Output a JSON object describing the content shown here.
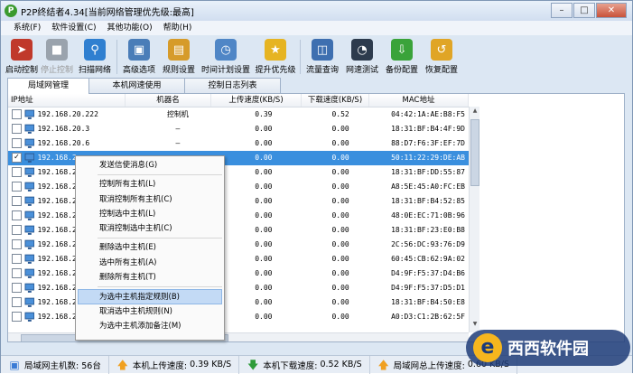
{
  "window": {
    "title": "P2P终结者4.34[当前网络管理优先级:最高]",
    "icon": "p2p-app-icon"
  },
  "menu": [
    "系统(F)",
    "软件设置(C)",
    "其他功能(O)",
    "帮助(H)"
  ],
  "toolbar": [
    {
      "label": "启动控制",
      "icon": "rocket-icon",
      "color": "#c0392b",
      "disabled": false
    },
    {
      "label": "停止控制",
      "icon": "stop-icon",
      "color": "#9aa3ad",
      "disabled": true
    },
    {
      "label": "扫描网络",
      "icon": "magnifier-icon",
      "color": "#2f7fd0",
      "disabled": false
    },
    {
      "label": "高级选项",
      "icon": "monitor-icon",
      "color": "#4a7db8",
      "disabled": false
    },
    {
      "label": "规则设置",
      "icon": "clipboard-icon",
      "color": "#d69b2a",
      "disabled": false
    },
    {
      "label": "时间计划设置",
      "icon": "clock-icon",
      "color": "#4f86c6",
      "disabled": false
    },
    {
      "label": "提升优先级",
      "icon": "medal-icon",
      "color": "#e6b422",
      "disabled": false
    },
    {
      "label": "流量查询",
      "icon": "database-icon",
      "color": "#3e6fb0",
      "disabled": false
    },
    {
      "label": "网速测试",
      "icon": "gauge-icon",
      "color": "#2d3b4d",
      "disabled": false
    },
    {
      "label": "备份配置",
      "icon": "download-arrow-icon",
      "color": "#3aa33a",
      "disabled": false
    },
    {
      "label": "恢复配置",
      "icon": "restore-icon",
      "color": "#e0a526",
      "disabled": false
    }
  ],
  "tabs": [
    "局域网管理",
    "本机网速使用",
    "控制日志列表"
  ],
  "grid": {
    "headers": [
      "IP地址",
      "机器名",
      "上传速度(KB/S)",
      "下载速度(KB/S)",
      "MAC地址"
    ],
    "rows": [
      {
        "ip": "192.168.20.222",
        "name": "控制机",
        "up": "0.39",
        "down": "0.52",
        "mac": "04:42:1A:AE:B8:F5",
        "checked": false,
        "selected": false
      },
      {
        "ip": "192.168.20.3",
        "name": "—",
        "up": "0.00",
        "down": "0.00",
        "mac": "18:31:BF:B4:4F:9D",
        "checked": false,
        "selected": false
      },
      {
        "ip": "192.168.20.6",
        "name": "—",
        "up": "0.00",
        "down": "0.00",
        "mac": "88:D7:F6:3F:EF:7D",
        "checked": false,
        "selected": false
      },
      {
        "ip": "192.168.2",
        "name": "",
        "up": "0.00",
        "down": "0.00",
        "mac": "50:11:22:29:DE:AB",
        "checked": true,
        "selected": true
      },
      {
        "ip": "192.168.2",
        "name": "",
        "up": "0.00",
        "down": "0.00",
        "mac": "18:31:BF:DD:55:87",
        "checked": false,
        "selected": false
      },
      {
        "ip": "192.168.2",
        "name": "",
        "up": "0.00",
        "down": "0.00",
        "mac": "A8:5E:45:A0:FC:EB",
        "checked": false,
        "selected": false
      },
      {
        "ip": "192.168.2",
        "name": "",
        "up": "0.00",
        "down": "0.00",
        "mac": "18:31:BF:B4:52:85",
        "checked": false,
        "selected": false
      },
      {
        "ip": "192.168.2",
        "name": "",
        "up": "0.00",
        "down": "0.00",
        "mac": "48:0E:EC:71:0B:96",
        "checked": false,
        "selected": false
      },
      {
        "ip": "192.168.2",
        "name": "",
        "up": "0.00",
        "down": "0.00",
        "mac": "18:31:BF:23:E0:B8",
        "checked": false,
        "selected": false
      },
      {
        "ip": "192.168.2",
        "name": "",
        "up": "0.00",
        "down": "0.00",
        "mac": "2C:56:DC:93:76:D9",
        "checked": false,
        "selected": false
      },
      {
        "ip": "192.168.2",
        "name": "",
        "up": "0.00",
        "down": "0.00",
        "mac": "60:45:CB:62:9A:02",
        "checked": false,
        "selected": false
      },
      {
        "ip": "192.168.2",
        "name": "",
        "up": "0.00",
        "down": "0.00",
        "mac": "D4:9F:F5:37:D4:B6",
        "checked": false,
        "selected": false
      },
      {
        "ip": "192.168.2",
        "name": "",
        "up": "0.00",
        "down": "0.00",
        "mac": "D4:9F:F5:37:D5:D1",
        "checked": false,
        "selected": false
      },
      {
        "ip": "192.168.2",
        "name": "",
        "up": "0.00",
        "down": "0.00",
        "mac": "18:31:BF:B4:50:E8",
        "checked": false,
        "selected": false
      },
      {
        "ip": "192.168.2",
        "name": "",
        "up": "0.00",
        "down": "0.00",
        "mac": "A0:D3:C1:2B:62:5F",
        "checked": false,
        "selected": false
      }
    ]
  },
  "context_menu": [
    {
      "label": "发送信使消息(G)"
    },
    {
      "sep": true
    },
    {
      "label": "控制所有主机(L)"
    },
    {
      "label": "取消控制所有主机(C)"
    },
    {
      "label": "控制选中主机(L)"
    },
    {
      "label": "取消控制选中主机(C)"
    },
    {
      "sep": true
    },
    {
      "label": "删除选中主机(E)"
    },
    {
      "label": "选中所有主机(A)"
    },
    {
      "label": "删除所有主机(T)"
    },
    {
      "sep": true
    },
    {
      "label": "为选中主机指定规则(B)",
      "highlight": true
    },
    {
      "label": "取消选中主机规则(N)"
    },
    {
      "label": "为选中主机添加备注(M)"
    }
  ],
  "status": {
    "hosts_label": "局域网主机数:",
    "hosts": "56台",
    "up_label": "本机上传速度:",
    "up": "0.39 KB/S",
    "down_label": "本机下载速度:",
    "down": "0.52 KB/S",
    "total_label": "局域网总上传速度:",
    "total": "0.60 KB/S"
  },
  "watermark": {
    "text": "西西软件园",
    "badge": "e"
  }
}
